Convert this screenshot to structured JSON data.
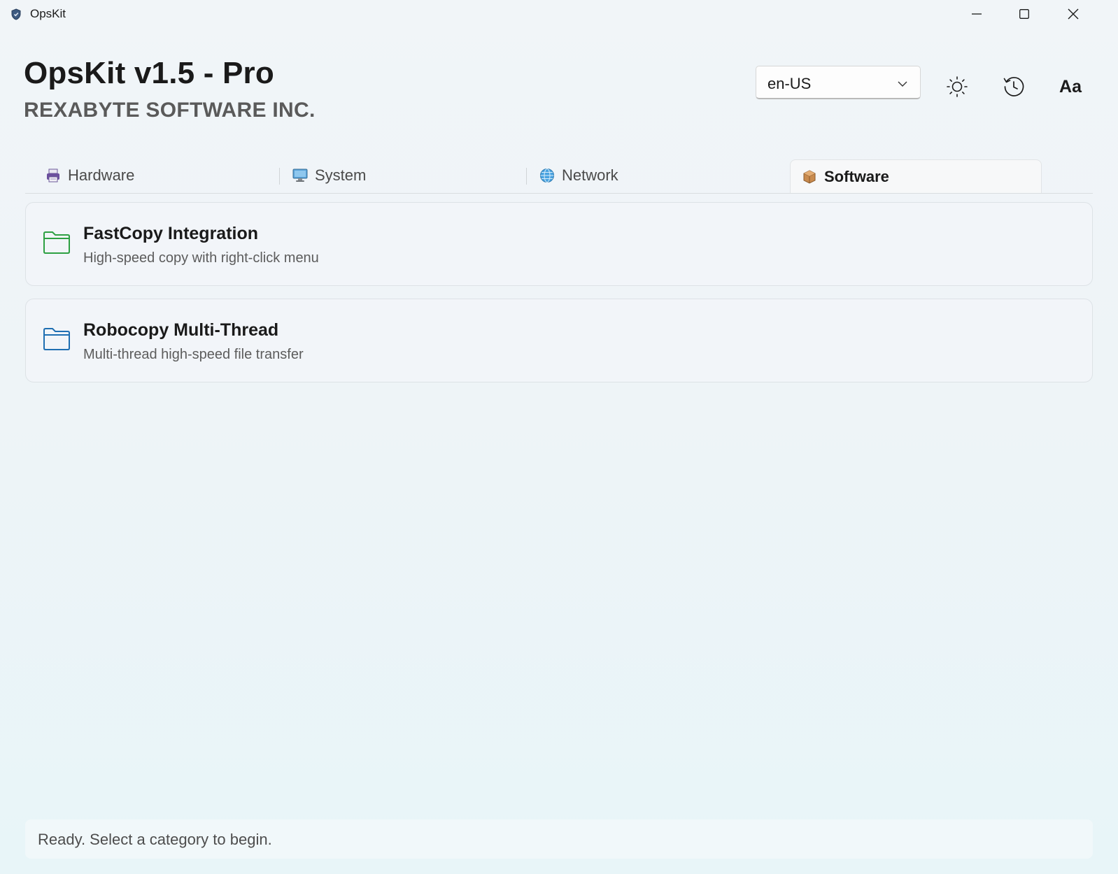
{
  "window": {
    "title": "OpsKit",
    "controls": [
      "minimize",
      "maximize",
      "close"
    ]
  },
  "header": {
    "title": "OpsKit v1.5 - Pro",
    "subtitle": "REXABYTE SOFTWARE INC.",
    "language": {
      "selected": "en-US"
    },
    "toolbar": {
      "theme_icon": "sun-icon",
      "history_icon": "history-icon",
      "font_label": "Aa"
    }
  },
  "tabs": [
    {
      "label": "Hardware",
      "icon": "printer-icon",
      "active": false
    },
    {
      "label": "System",
      "icon": "monitor-icon",
      "active": false
    },
    {
      "label": "Network",
      "icon": "globe-icon",
      "active": false
    },
    {
      "label": "Software",
      "icon": "package-icon",
      "active": true
    }
  ],
  "items": [
    {
      "title": "FastCopy Integration",
      "description": "High-speed copy with right-click menu",
      "icon": "folder-icon",
      "icon_color": "#2ea043"
    },
    {
      "title": "Robocopy Multi-Thread",
      "description": "Multi-thread high-speed file transfer",
      "icon": "folder-icon",
      "icon_color": "#1f6fb2"
    }
  ],
  "status": {
    "text": "Ready. Select a category to begin."
  }
}
